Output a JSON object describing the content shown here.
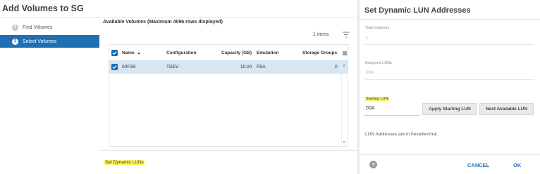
{
  "left_dialog": {
    "title": "Add Volumes to SG",
    "steps": [
      {
        "num": "1",
        "label": "Find Volumes"
      },
      {
        "num": "2",
        "label": "Select Volumes"
      }
    ],
    "available_title": "Available Volumes (Maximum 4096 rows displayed)",
    "items_count": "1 items",
    "table": {
      "columns": [
        "Name",
        "Configuration",
        "Capacity (GB)",
        "Emulation",
        "Storage Groups"
      ],
      "sort_indicator": "▲",
      "rows": [
        {
          "name": "00F2B",
          "configuration": "TDEV",
          "capacity": "10.00",
          "emulation": "FBA",
          "storage_groups": "0",
          "checked": true
        }
      ]
    },
    "set_dynamic_luns_link": "Set Dynamic LUNs"
  },
  "right_dialog": {
    "title": "Set Dynamic LUN Addresses",
    "total_volumes_label": "Total Volumes",
    "total_volumes_value": "1",
    "assigned_luns_label": "Assigned LUNs",
    "assigned_luns_value": "00A",
    "starting_lun_label": "Starting LUN",
    "starting_lun_value": "00A",
    "apply_button": "Apply Starting LUN",
    "next_button": "Next Available LUN",
    "note": "LUN Addresses are in hexadecimal",
    "help_icon_glyph": "?",
    "cancel": "CANCEL",
    "ok": "OK"
  },
  "colors": {
    "accent": "#1f6fb5",
    "selected_row": "#d6e6f3",
    "highlight": "#fbf56a"
  }
}
